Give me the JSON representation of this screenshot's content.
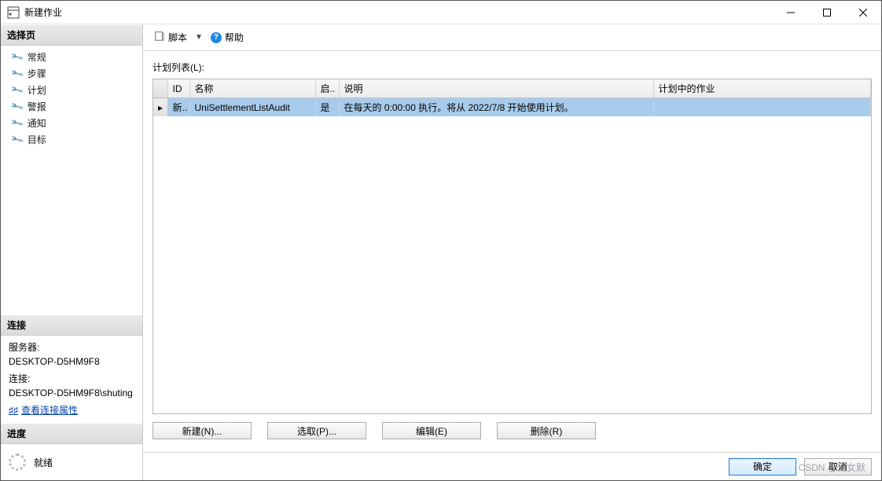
{
  "window": {
    "title": "新建作业"
  },
  "sidebar": {
    "select_page": "选择页",
    "nav": [
      "常规",
      "步骤",
      "计划",
      "警报",
      "通知",
      "目标"
    ],
    "connection": {
      "header": "连接",
      "server_label": "服务器:",
      "server_value": "DESKTOP-D5HM9F8",
      "conn_label": "连接:",
      "conn_value": "DESKTOP-D5HM9F8\\shuting",
      "view_props": "查看连接属性"
    },
    "progress": {
      "header": "进度",
      "status": "就绪"
    }
  },
  "toolbar": {
    "script": "脚本",
    "help": "帮助"
  },
  "content": {
    "list_label": "计划列表(L):",
    "columns": {
      "id": "ID",
      "name": "名称",
      "enabled": "启..",
      "desc": "说明",
      "schedjob": "计划中的作业"
    },
    "rows": [
      {
        "id": "新..",
        "name": "UniSettlementListAudit",
        "enabled": "是",
        "desc": "在每天的 0:00:00 执行。将从 2022/7/8 开始使用计划。",
        "schedjob": ""
      }
    ],
    "buttons": {
      "new": "新建(N)...",
      "pick": "选取(P)...",
      "edit": "编辑(E)",
      "remove": "删除(R)"
    }
  },
  "footer": {
    "ok": "确定",
    "cancel": "取消",
    "watermark": "CSDN @仙女默"
  }
}
